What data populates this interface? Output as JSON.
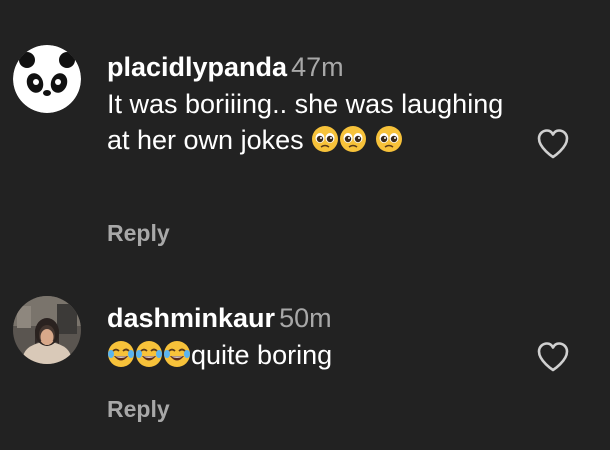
{
  "comments": [
    {
      "username": "placidlypanda",
      "time": "47m",
      "text": "It was boriiing.. she was laughing at her own jokes",
      "emojis": [
        "pleading-face",
        "pleading-face",
        "pleading-face"
      ],
      "reply_label": "Reply",
      "avatar_icon": "panda-avatar-icon"
    },
    {
      "username": "dashminkaur",
      "time": "50m",
      "text": "quite boring",
      "emojis": [
        "joy-face",
        "joy-face",
        "joy-face"
      ],
      "reply_label": "Reply",
      "avatar_icon": "profile-photo-avatar"
    }
  ],
  "colors": {
    "background": "#222222",
    "primary_text": "#ffffff",
    "secondary_text": "#a8a8a8"
  }
}
